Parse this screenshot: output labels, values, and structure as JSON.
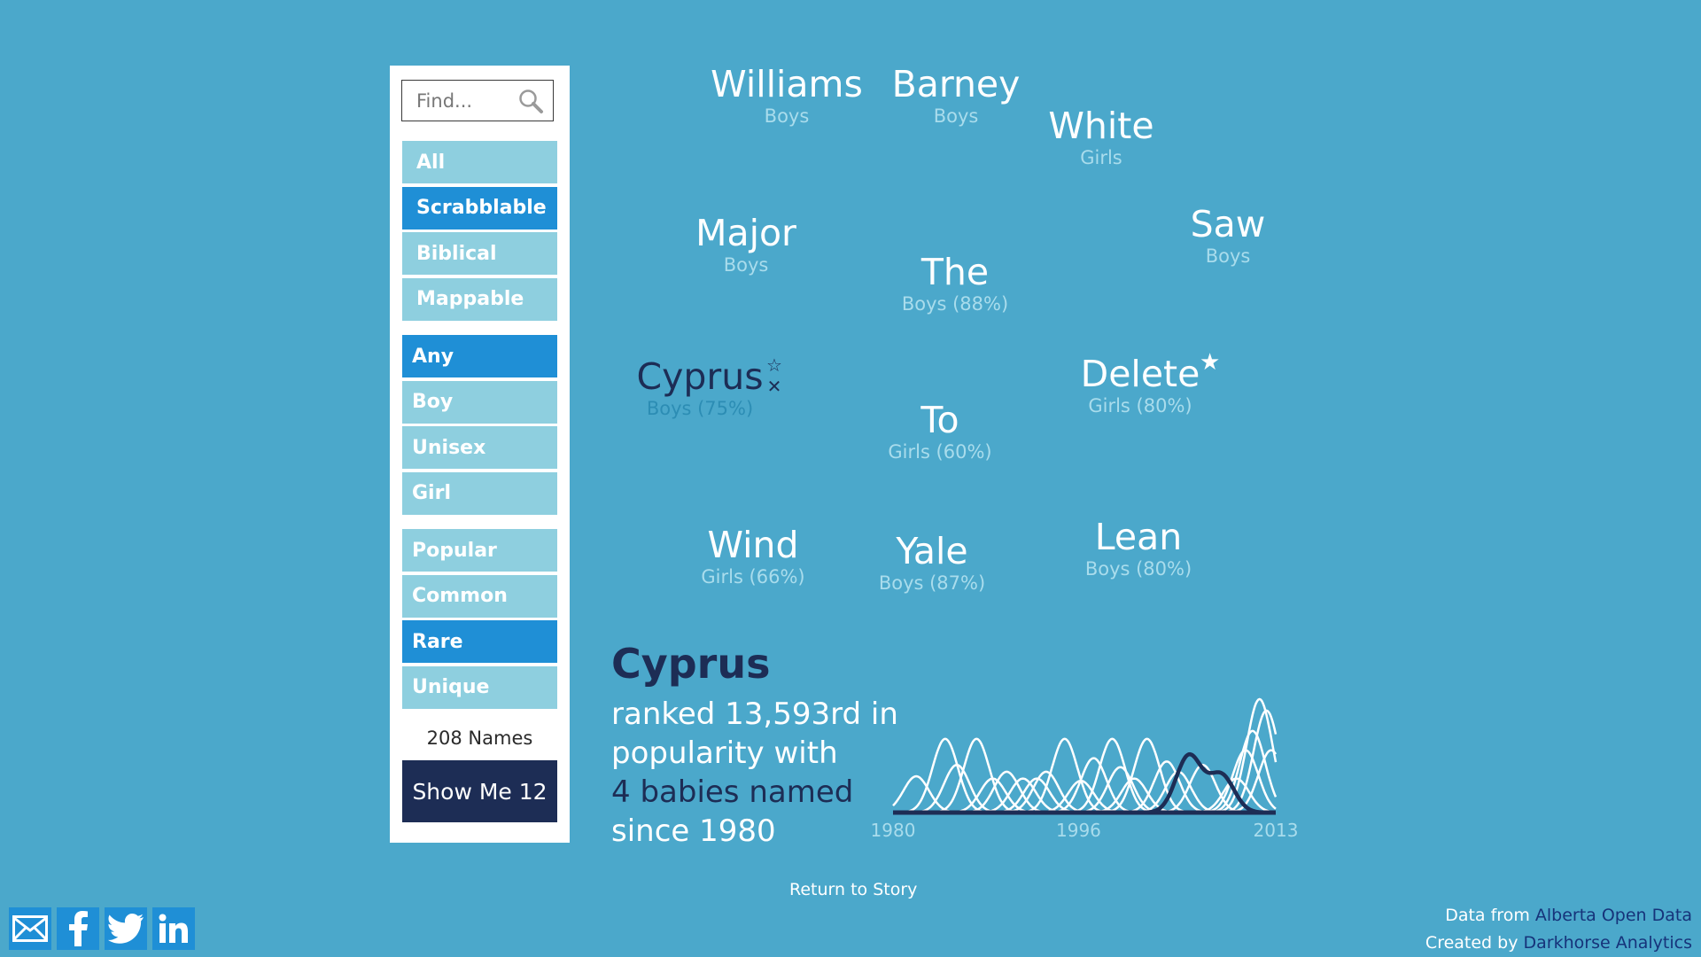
{
  "search": {
    "placeholder": "Find..."
  },
  "filters": {
    "list": [
      {
        "label": "All",
        "active": false
      },
      {
        "label": "Scrabblable",
        "active": true
      },
      {
        "label": "Biblical",
        "active": false
      },
      {
        "label": "Mappable",
        "active": false
      }
    ],
    "gender": [
      {
        "label": "Any",
        "active": true
      },
      {
        "label": "Boy",
        "active": false
      },
      {
        "label": "Unisex",
        "active": false
      },
      {
        "label": "Girl",
        "active": false
      }
    ],
    "popularity": [
      {
        "label": "Popular",
        "active": false
      },
      {
        "label": "Common",
        "active": false
      },
      {
        "label": "Rare",
        "active": true
      },
      {
        "label": "Unique",
        "active": false
      }
    ]
  },
  "count_label": "208 Names",
  "show_button": "Show Me 12",
  "names": [
    {
      "name": "Williams",
      "gender": "Boys"
    },
    {
      "name": "Barney",
      "gender": "Boys"
    },
    {
      "name": "White",
      "gender": "Girls"
    },
    {
      "name": "Major",
      "gender": "Boys"
    },
    {
      "name": "Saw",
      "gender": "Boys"
    },
    {
      "name": "The",
      "gender": "Boys (88%)"
    },
    {
      "name": "Cyprus",
      "gender": "Boys (75%)",
      "selected": true
    },
    {
      "name": "Delete",
      "gender": "Girls (80%)",
      "starred": true
    },
    {
      "name": "To",
      "gender": "Girls (60%)"
    },
    {
      "name": "Wind",
      "gender": "Girls (66%)"
    },
    {
      "name": "Yale",
      "gender": "Boys (87%)"
    },
    {
      "name": "Lean",
      "gender": "Boys (80%)"
    }
  ],
  "detail": {
    "name": "Cyprus",
    "line1": "ranked 13,593rd in",
    "line2": "popularity with",
    "line3": "4 babies named",
    "line4": "since 1980"
  },
  "chart_data": {
    "type": "line",
    "x_range": [
      1980,
      2013
    ],
    "tick_labels": [
      "1980",
      "1996",
      "2013"
    ],
    "highlight_series": {
      "name": "Cyprus",
      "color": "#1d2d55",
      "peaks": [
        {
          "year": 2005.5,
          "height": 0.5
        },
        {
          "year": 2008.3,
          "height": 0.33
        }
      ]
    },
    "background_series_color": "#ffffff",
    "background_peaks": [
      {
        "year": 1982,
        "height": 0.32
      },
      {
        "year": 1984.5,
        "height": 0.65
      },
      {
        "year": 1985.5,
        "height": 0.42
      },
      {
        "year": 1987.2,
        "height": 0.65
      },
      {
        "year": 1988.6,
        "height": 0.3
      },
      {
        "year": 1989.8,
        "height": 0.36
      },
      {
        "year": 1991.2,
        "height": 0.3
      },
      {
        "year": 1992.4,
        "height": 0.3
      },
      {
        "year": 1993.2,
        "height": 0.36
      },
      {
        "year": 1994.8,
        "height": 0.65
      },
      {
        "year": 1996.2,
        "height": 0.28
      },
      {
        "year": 1997.3,
        "height": 0.48
      },
      {
        "year": 1998.9,
        "height": 0.65
      },
      {
        "year": 1999.6,
        "height": 0.4
      },
      {
        "year": 2000.8,
        "height": 0.3
      },
      {
        "year": 2001.9,
        "height": 0.65
      },
      {
        "year": 2003.6,
        "height": 0.45
      },
      {
        "year": 2004.6,
        "height": 0.36
      },
      {
        "year": 2006.7,
        "height": 0.42
      },
      {
        "year": 2009.6,
        "height": 0.3
      },
      {
        "year": 2010.4,
        "height": 0.55
      },
      {
        "year": 2011.0,
        "height": 0.72
      },
      {
        "year": 2011.6,
        "height": 1.0
      },
      {
        "year": 2012.2,
        "height": 0.9
      },
      {
        "year": 2012.6,
        "height": 0.55
      }
    ]
  },
  "footer": {
    "return_link": "Return to Story",
    "data_from": "Data from",
    "data_source": "Alberta Open Data",
    "created_by": "Created by",
    "creator": "Darkhorse Analytics"
  }
}
